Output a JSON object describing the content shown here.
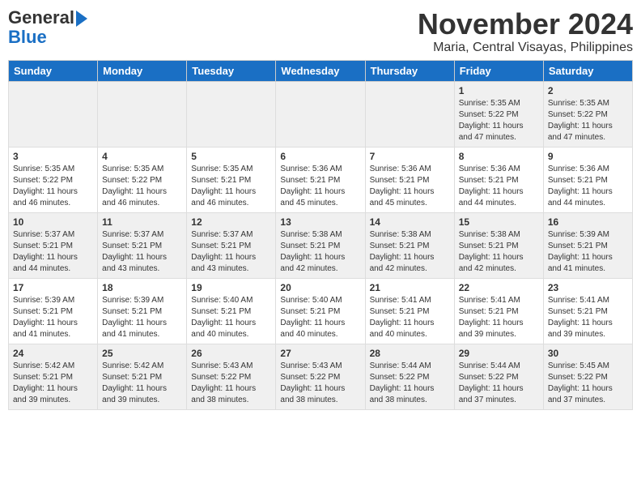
{
  "logo": {
    "line1": "General",
    "line2": "Blue"
  },
  "title": "November 2024",
  "location": "Maria, Central Visayas, Philippines",
  "days_of_week": [
    "Sunday",
    "Monday",
    "Tuesday",
    "Wednesday",
    "Thursday",
    "Friday",
    "Saturday"
  ],
  "weeks": [
    [
      {
        "day": "",
        "info": ""
      },
      {
        "day": "",
        "info": ""
      },
      {
        "day": "",
        "info": ""
      },
      {
        "day": "",
        "info": ""
      },
      {
        "day": "",
        "info": ""
      },
      {
        "day": "1",
        "info": "Sunrise: 5:35 AM\nSunset: 5:22 PM\nDaylight: 11 hours\nand 47 minutes."
      },
      {
        "day": "2",
        "info": "Sunrise: 5:35 AM\nSunset: 5:22 PM\nDaylight: 11 hours\nand 47 minutes."
      }
    ],
    [
      {
        "day": "3",
        "info": "Sunrise: 5:35 AM\nSunset: 5:22 PM\nDaylight: 11 hours\nand 46 minutes."
      },
      {
        "day": "4",
        "info": "Sunrise: 5:35 AM\nSunset: 5:22 PM\nDaylight: 11 hours\nand 46 minutes."
      },
      {
        "day": "5",
        "info": "Sunrise: 5:35 AM\nSunset: 5:21 PM\nDaylight: 11 hours\nand 46 minutes."
      },
      {
        "day": "6",
        "info": "Sunrise: 5:36 AM\nSunset: 5:21 PM\nDaylight: 11 hours\nand 45 minutes."
      },
      {
        "day": "7",
        "info": "Sunrise: 5:36 AM\nSunset: 5:21 PM\nDaylight: 11 hours\nand 45 minutes."
      },
      {
        "day": "8",
        "info": "Sunrise: 5:36 AM\nSunset: 5:21 PM\nDaylight: 11 hours\nand 44 minutes."
      },
      {
        "day": "9",
        "info": "Sunrise: 5:36 AM\nSunset: 5:21 PM\nDaylight: 11 hours\nand 44 minutes."
      }
    ],
    [
      {
        "day": "10",
        "info": "Sunrise: 5:37 AM\nSunset: 5:21 PM\nDaylight: 11 hours\nand 44 minutes."
      },
      {
        "day": "11",
        "info": "Sunrise: 5:37 AM\nSunset: 5:21 PM\nDaylight: 11 hours\nand 43 minutes."
      },
      {
        "day": "12",
        "info": "Sunrise: 5:37 AM\nSunset: 5:21 PM\nDaylight: 11 hours\nand 43 minutes."
      },
      {
        "day": "13",
        "info": "Sunrise: 5:38 AM\nSunset: 5:21 PM\nDaylight: 11 hours\nand 42 minutes."
      },
      {
        "day": "14",
        "info": "Sunrise: 5:38 AM\nSunset: 5:21 PM\nDaylight: 11 hours\nand 42 minutes."
      },
      {
        "day": "15",
        "info": "Sunrise: 5:38 AM\nSunset: 5:21 PM\nDaylight: 11 hours\nand 42 minutes."
      },
      {
        "day": "16",
        "info": "Sunrise: 5:39 AM\nSunset: 5:21 PM\nDaylight: 11 hours\nand 41 minutes."
      }
    ],
    [
      {
        "day": "17",
        "info": "Sunrise: 5:39 AM\nSunset: 5:21 PM\nDaylight: 11 hours\nand 41 minutes."
      },
      {
        "day": "18",
        "info": "Sunrise: 5:39 AM\nSunset: 5:21 PM\nDaylight: 11 hours\nand 41 minutes."
      },
      {
        "day": "19",
        "info": "Sunrise: 5:40 AM\nSunset: 5:21 PM\nDaylight: 11 hours\nand 40 minutes."
      },
      {
        "day": "20",
        "info": "Sunrise: 5:40 AM\nSunset: 5:21 PM\nDaylight: 11 hours\nand 40 minutes."
      },
      {
        "day": "21",
        "info": "Sunrise: 5:41 AM\nSunset: 5:21 PM\nDaylight: 11 hours\nand 40 minutes."
      },
      {
        "day": "22",
        "info": "Sunrise: 5:41 AM\nSunset: 5:21 PM\nDaylight: 11 hours\nand 39 minutes."
      },
      {
        "day": "23",
        "info": "Sunrise: 5:41 AM\nSunset: 5:21 PM\nDaylight: 11 hours\nand 39 minutes."
      }
    ],
    [
      {
        "day": "24",
        "info": "Sunrise: 5:42 AM\nSunset: 5:21 PM\nDaylight: 11 hours\nand 39 minutes."
      },
      {
        "day": "25",
        "info": "Sunrise: 5:42 AM\nSunset: 5:21 PM\nDaylight: 11 hours\nand 39 minutes."
      },
      {
        "day": "26",
        "info": "Sunrise: 5:43 AM\nSunset: 5:22 PM\nDaylight: 11 hours\nand 38 minutes."
      },
      {
        "day": "27",
        "info": "Sunrise: 5:43 AM\nSunset: 5:22 PM\nDaylight: 11 hours\nand 38 minutes."
      },
      {
        "day": "28",
        "info": "Sunrise: 5:44 AM\nSunset: 5:22 PM\nDaylight: 11 hours\nand 38 minutes."
      },
      {
        "day": "29",
        "info": "Sunrise: 5:44 AM\nSunset: 5:22 PM\nDaylight: 11 hours\nand 37 minutes."
      },
      {
        "day": "30",
        "info": "Sunrise: 5:45 AM\nSunset: 5:22 PM\nDaylight: 11 hours\nand 37 minutes."
      }
    ]
  ]
}
